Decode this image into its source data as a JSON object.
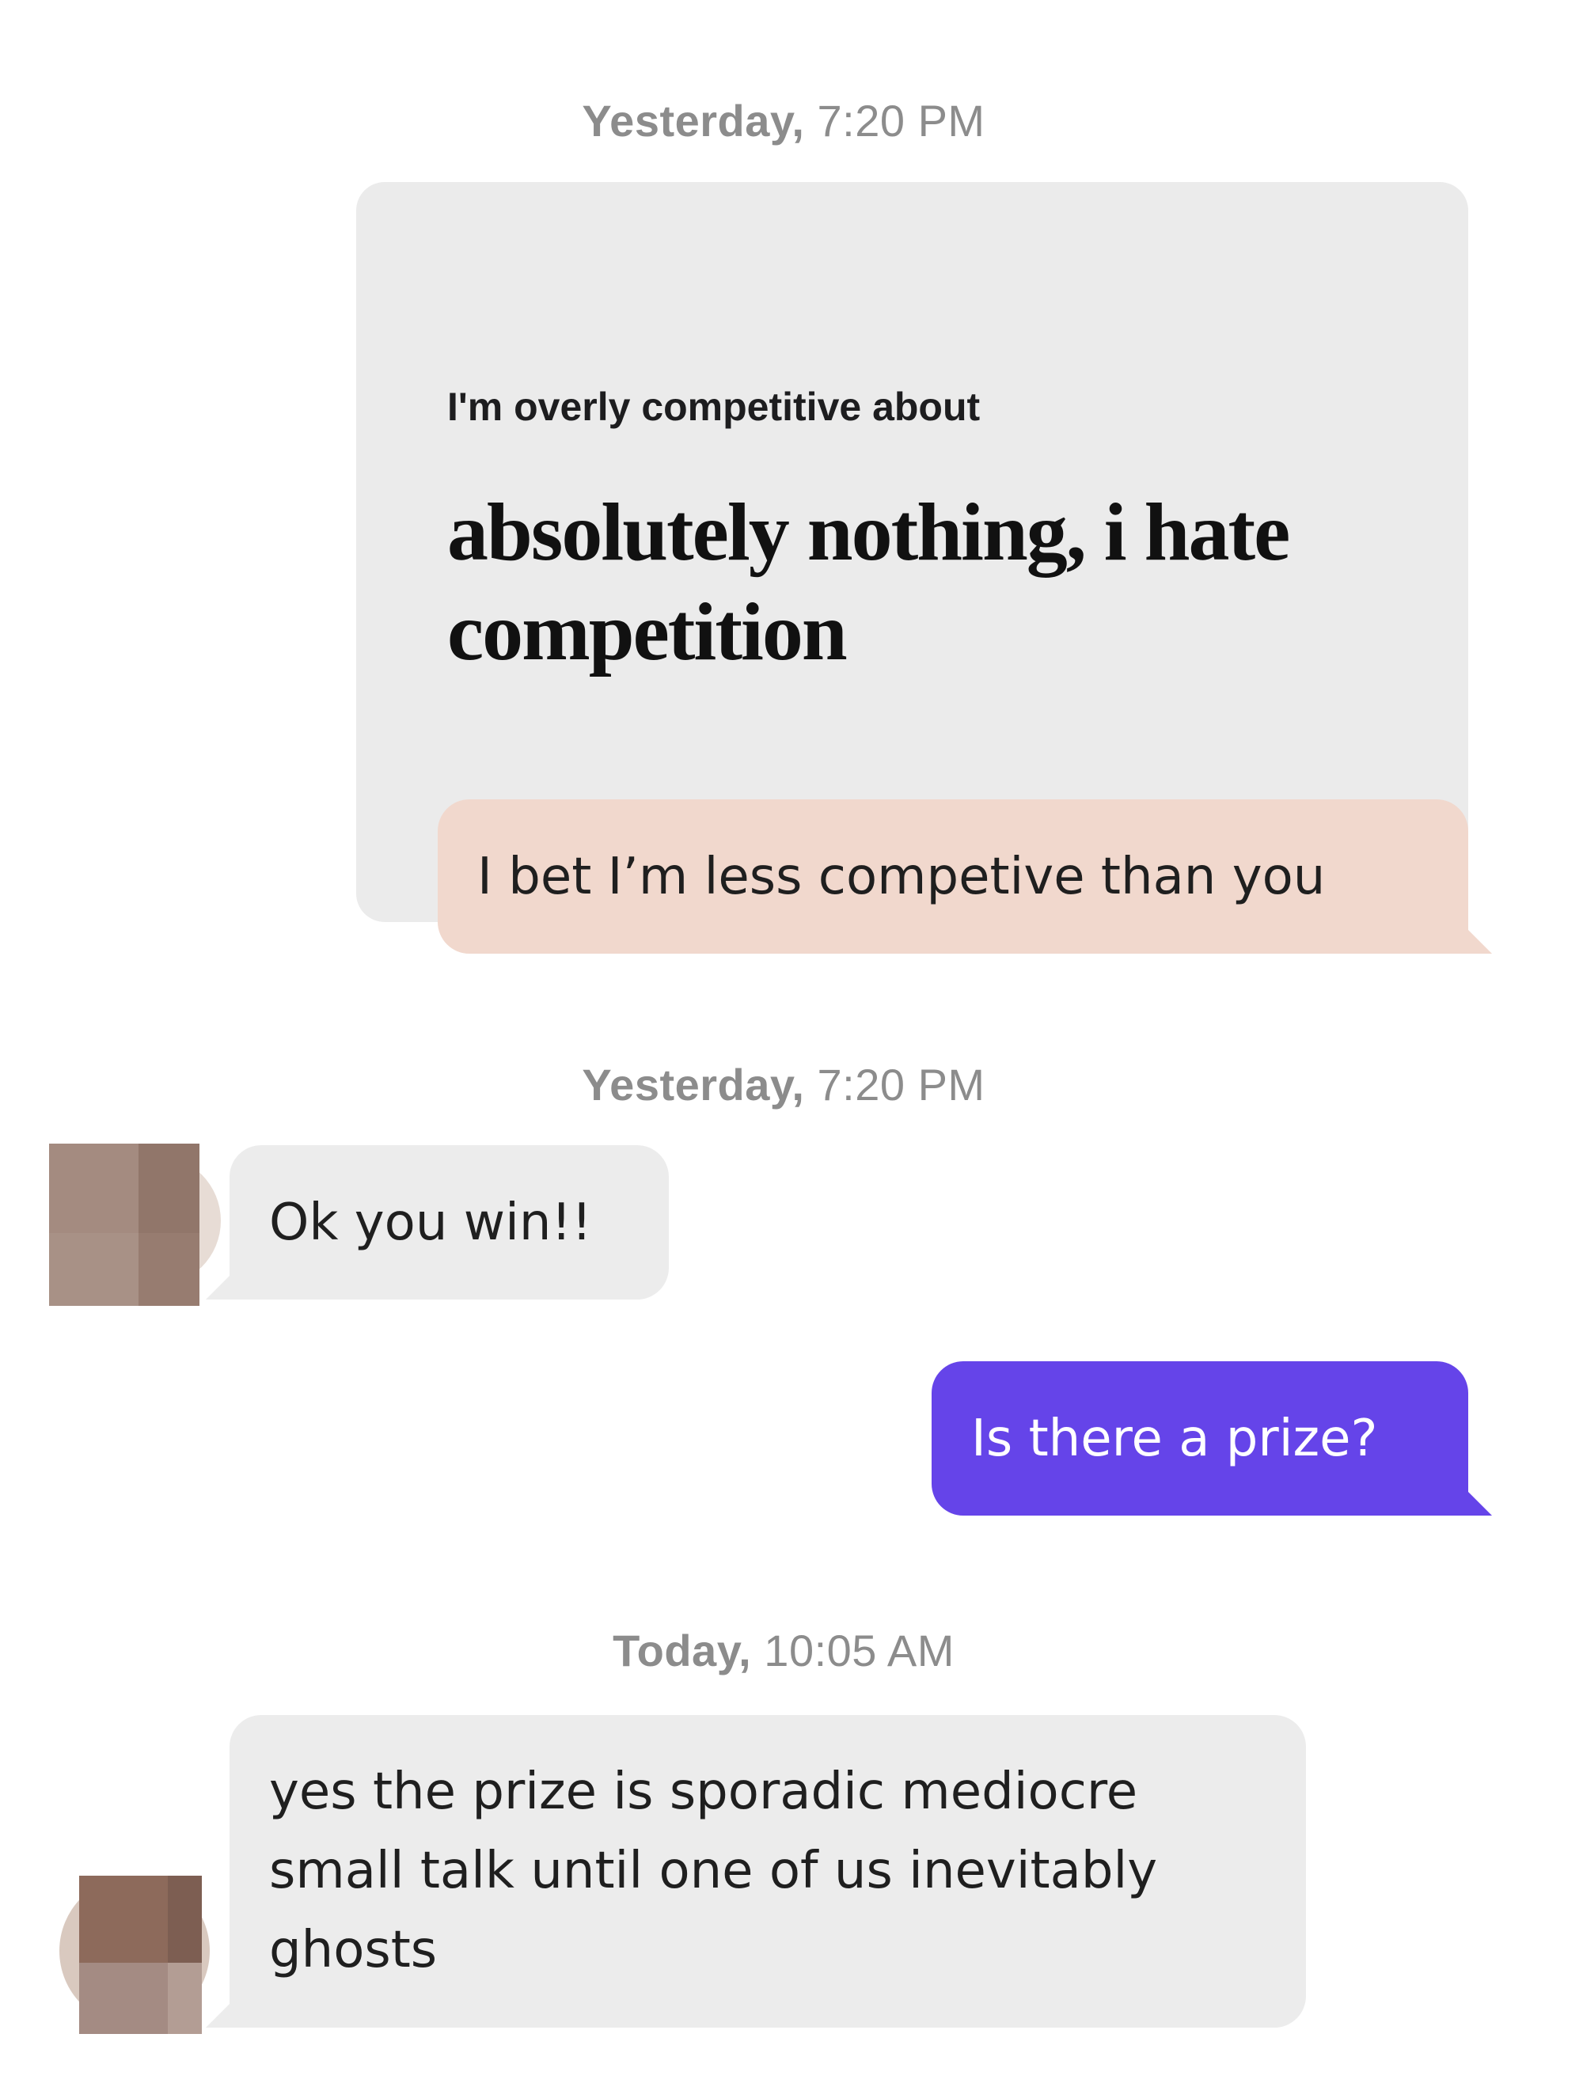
{
  "conversation": {
    "timestamps": [
      {
        "day": "Yesterday,",
        "time": " 7:20 PM"
      },
      {
        "day": "Yesterday,",
        "time": " 7:20 PM"
      },
      {
        "day": "Today,",
        "time": " 10:05 AM"
      }
    ],
    "prompt_card": {
      "label": "I'm overly competitive about",
      "answer": "absolutely nothing, i hate competition"
    },
    "messages": [
      {
        "sender": "me",
        "style": "prompt-reply",
        "text": "I bet I’m less competive than you"
      },
      {
        "sender": "them",
        "text": "Ok you win!!"
      },
      {
        "sender": "me",
        "text": "Is there a prize?"
      },
      {
        "sender": "them",
        "text": "yes the prize is sporadic mediocre small talk until one of us inevitably ghosts"
      }
    ]
  },
  "colors": {
    "prompt_card": "#ebebeb",
    "prompt_reply_bubble": "#f1d8cd",
    "incoming_bubble": "#ececec",
    "outgoing_bubble": "#6544e9",
    "timestamp": "#8c8c8c"
  },
  "avatars": [
    {
      "name": "match-avatar",
      "style": "pixelated"
    },
    {
      "name": "match-avatar",
      "style": "pixelated"
    }
  ]
}
